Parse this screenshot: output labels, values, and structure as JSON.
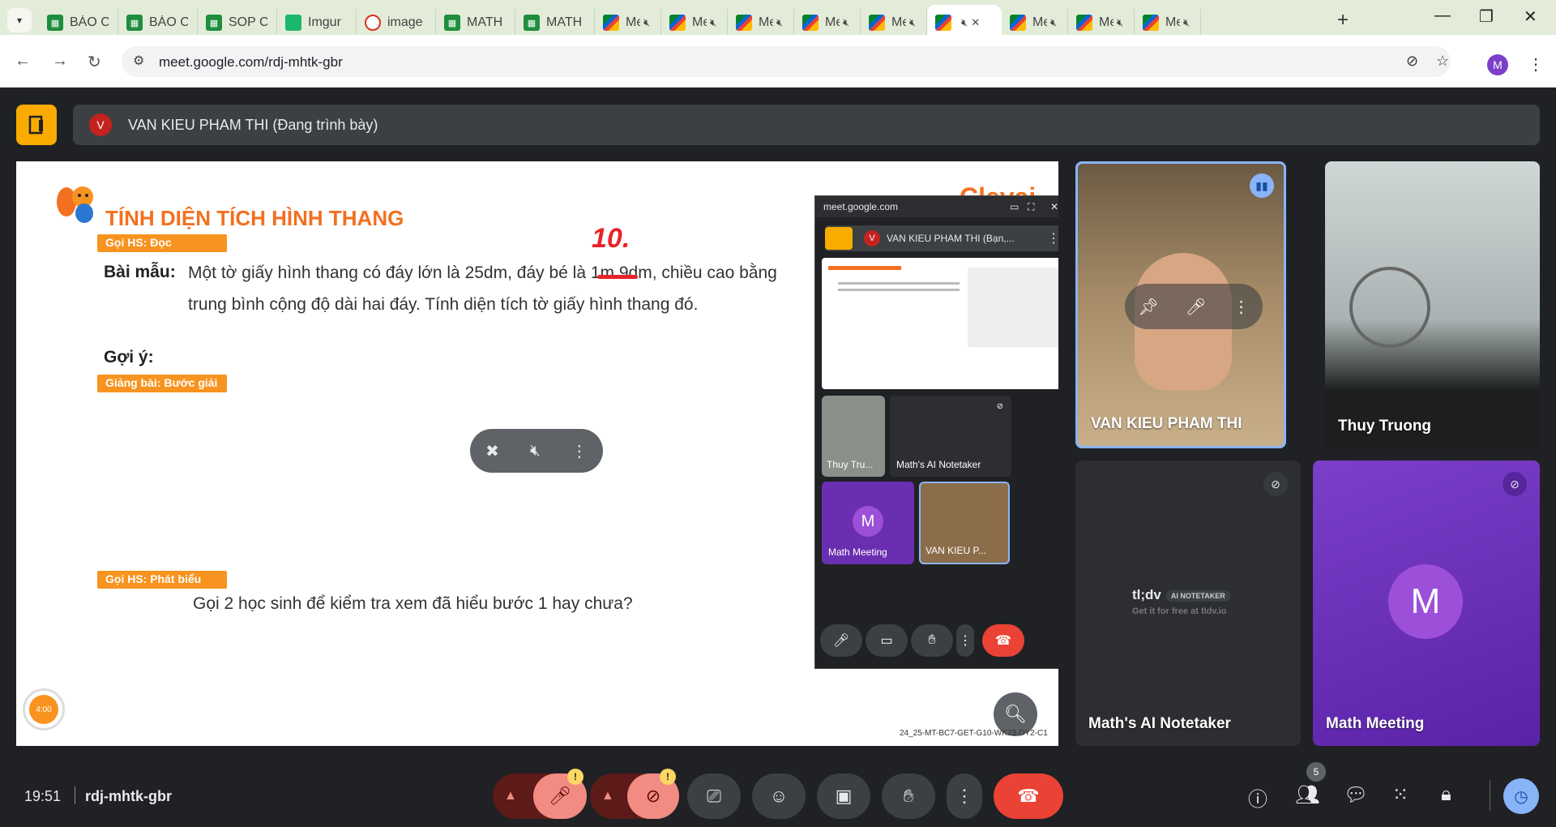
{
  "browser": {
    "tabs": [
      {
        "title": "BÁO C",
        "icon": "sheets-icon"
      },
      {
        "title": "BÁO C",
        "icon": "sheets-icon"
      },
      {
        "title": "SOP C",
        "icon": "sheets-icon"
      },
      {
        "title": "Imgur",
        "icon": "imgur-icon"
      },
      {
        "title": "image",
        "icon": "image-icon"
      },
      {
        "title": "MATH",
        "icon": "sheets-icon"
      },
      {
        "title": "MATH",
        "icon": "sheets-icon"
      },
      {
        "title": "Me",
        "icon": "meet-icon"
      },
      {
        "title": "Me",
        "icon": "meet-icon"
      },
      {
        "title": "Me",
        "icon": "meet-icon"
      },
      {
        "title": "Me",
        "icon": "meet-icon"
      },
      {
        "title": "Me",
        "icon": "meet-icon"
      },
      {
        "title": "",
        "icon": "meet-icon",
        "active": true
      },
      {
        "title": "Me",
        "icon": "meet-icon"
      },
      {
        "title": "Me",
        "icon": "meet-icon"
      },
      {
        "title": "Me",
        "icon": "meet-icon"
      }
    ],
    "url": "meet.google.com/rdj-mhtk-gbr",
    "profile_initial": "M"
  },
  "meet": {
    "presenter_initial": "V",
    "presenter_label": "VAN KIEU PHAM THI (Đang trình bày)",
    "meeting_code": "rdj-mhtk-gbr",
    "time": "19:51",
    "people_count": "5"
  },
  "slide": {
    "title": "TÍNH DIỆN TÍCH HÌNH THANG",
    "brand": "Clevai",
    "label_read": "Gọi HS: Đọc",
    "bai_mau": "Bài mẫu:",
    "problem": "Một tờ giấy hình thang có đáy lớn là 25dm, đáy bé là 1m 9dm, chiều cao bằng trung bình cộng độ dài hai đáy. Tính diện tích tờ giấy hình thang đó.",
    "goi_y": "Gợi ý:",
    "label_lecture": "Giảng bài: Bước giải",
    "label_speak": "Gọi HS: Phát biểu",
    "call_text": "Gọi 2 học sinh để kiểm tra xem đã hiểu bước 1 hay chưa?",
    "handwriting": "10.",
    "code": "24_25-MT-BC7-GET-G10-WK23-DY2-C1",
    "timer": "4:00"
  },
  "pip": {
    "url": "meet.google.com",
    "presenter_label": "VAN KIEU PHAM THI (Bạn,...",
    "presenter_initial": "V",
    "tiles": [
      {
        "name": "Thuy Tru..."
      },
      {
        "name": "Math's AI Notetaker"
      },
      {
        "name": "Math Meeting",
        "initial": "M"
      },
      {
        "name": "VAN KIEU P..."
      }
    ]
  },
  "tiles": [
    {
      "name": "VAN KIEU PHAM THI"
    },
    {
      "name": "Thuy Truong"
    },
    {
      "name": "Math's AI Notetaker",
      "brand": "tl;dv",
      "badge": "AI NOTETAKER",
      "sub": "Get it for free at tldv.io"
    },
    {
      "name": "Math Meeting",
      "initial": "M"
    }
  ],
  "colors": {
    "accent": "#f37021",
    "meet_red": "#ea4335",
    "leave_yellow": "#f9ab00"
  }
}
